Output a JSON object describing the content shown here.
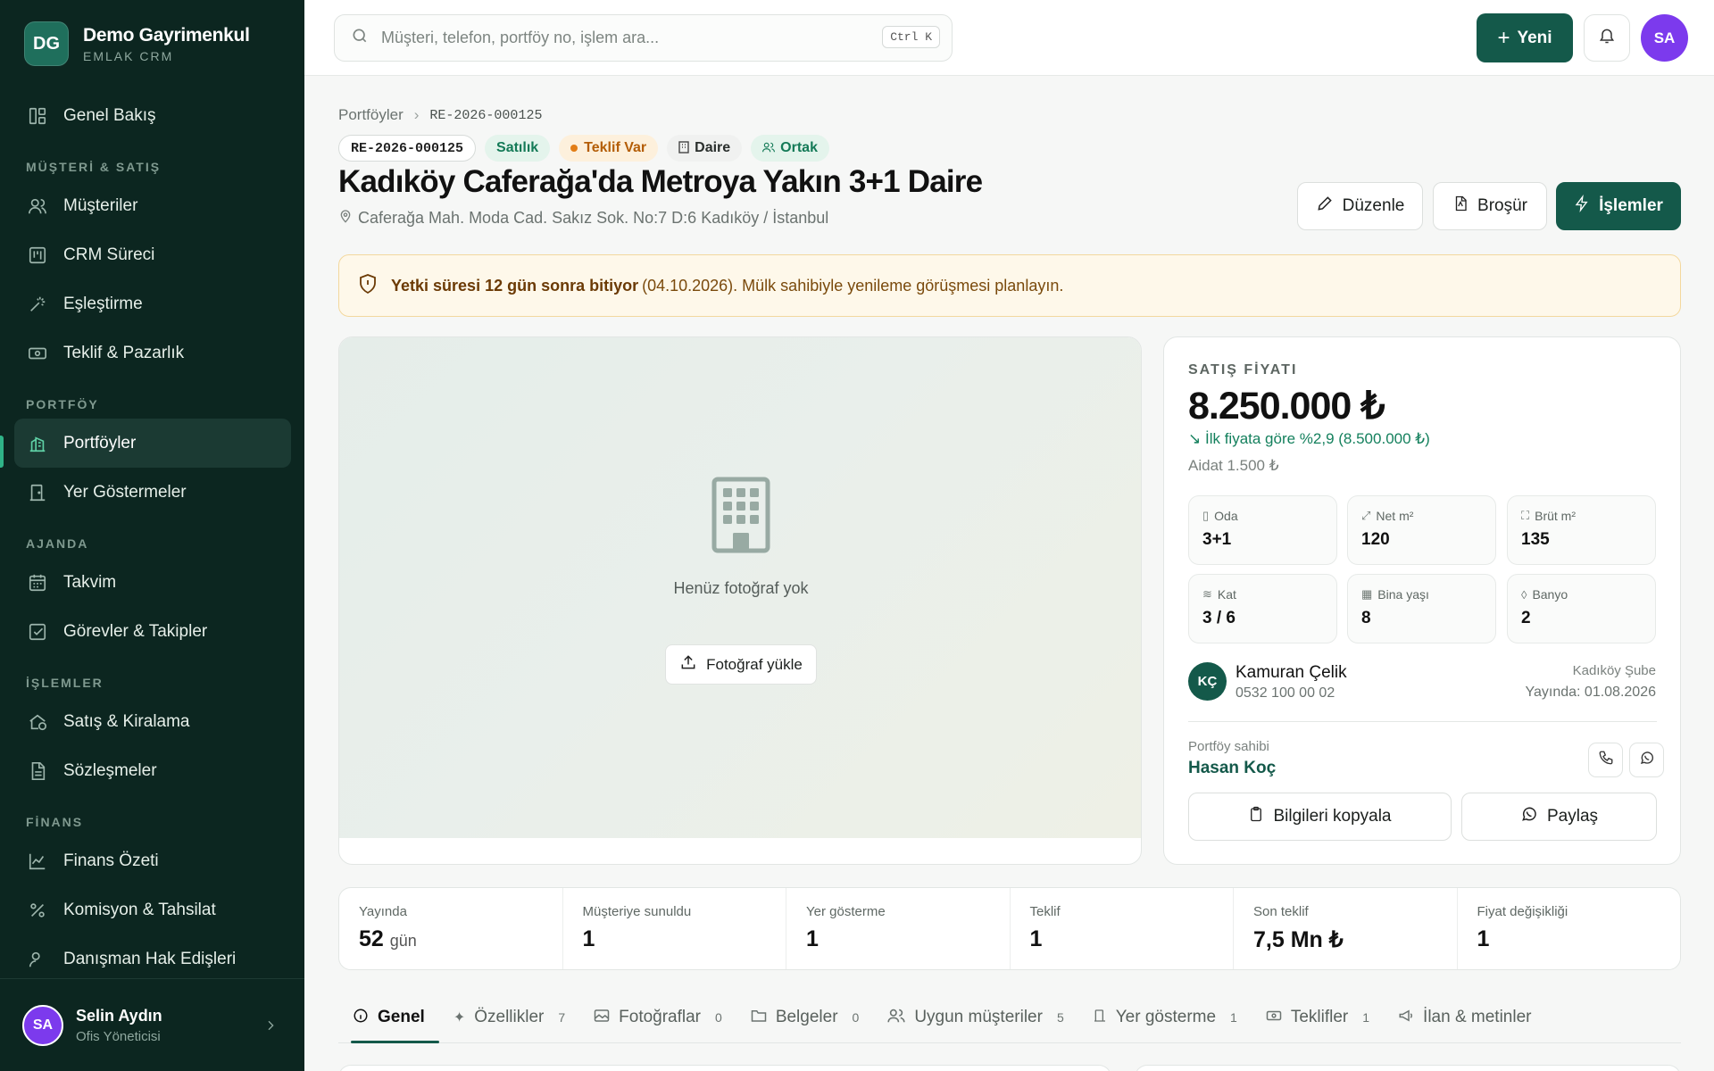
{
  "brand": {
    "logo": "DG",
    "name": "Demo Gayrimenkul",
    "sub": "EMLAK CRM"
  },
  "nav": {
    "overview": "Genel Bakış",
    "section_customers": "MÜŞTERİ & SATIŞ",
    "customers": "Müşteriler",
    "crm": "CRM Süreci",
    "matching": "Eşleştirme",
    "offers": "Teklif & Pazarlık",
    "section_portfolio": "PORTFÖY",
    "portfolios": "Portföyler",
    "showings": "Yer Göstermeler",
    "section_agenda": "AJANDA",
    "calendar": "Takvim",
    "tasks": "Görevler & Takipler",
    "section_ops": "İŞLEMLER",
    "sales": "Satış & Kiralama",
    "contracts": "Sözleşmeler",
    "section_finance": "FİNANS",
    "finance": "Finans Özeti",
    "commission": "Komisyon & Tahsilat",
    "partial": "Danışman Hak Edişleri"
  },
  "user": {
    "initials": "SA",
    "name": "Selin Aydın",
    "role": "Ofis Yöneticisi"
  },
  "topbar": {
    "search_placeholder": "Müşteri, telefon, portföy no, işlem ara...",
    "shortcut": "Ctrl K",
    "new_label": "Yeni",
    "avatar": "SA"
  },
  "breadcrumb": {
    "root": "Portföyler",
    "current": "RE-2026-000125"
  },
  "tags": {
    "code": "RE-2026-000125",
    "status": "Satılık",
    "offer": "Teklif Var",
    "type": "Daire",
    "shared": "Ortak"
  },
  "title": "Kadıköy Caferağa'da Metroya Yakın 3+1 Daire",
  "address": "Caferağa Mah. Moda Cad. Sakız Sok. No:7 D:6 Kadıköy / İstanbul",
  "actions": {
    "edit": "Düzenle",
    "brochure": "Broşür",
    "operations": "İşlemler"
  },
  "alert": {
    "bold": "Yetki süresi 12 gün sonra bitiyor",
    "rest": "(04.10.2026). Mülk sahibiyle yenileme görüşmesi planlayın."
  },
  "photo": {
    "empty": "Henüz fotoğraf yok",
    "upload": "Fotoğraf yükle"
  },
  "price": {
    "label": "SATIŞ FİYATI",
    "value": "8.250.000 ₺",
    "change": "↘ İlk fiyata göre %2,9 (8.500.000 ₺)",
    "aidat": "Aidat 1.500 ₺",
    "specs": [
      {
        "label": "Oda",
        "value": "3+1"
      },
      {
        "label": "Net m²",
        "value": "120"
      },
      {
        "label": "Brüt m²",
        "value": "135"
      },
      {
        "label": "Kat",
        "value": "3 / 6"
      },
      {
        "label": "Bina yaşı",
        "value": "8"
      },
      {
        "label": "Banyo",
        "value": "2"
      }
    ],
    "agent": {
      "initials": "KÇ",
      "name": "Kamuran Çelik",
      "phone": "0532 100 00 02",
      "branch": "Kadıköy Şube",
      "published": "Yayında: 01.08.2026"
    },
    "owner_label": "Portföy sahibi",
    "owner_name": "Hasan Koç",
    "copy": "Bilgileri kopyala",
    "share": "Paylaş"
  },
  "stats": [
    {
      "label": "Yayında",
      "value": "52",
      "unit": "gün"
    },
    {
      "label": "Müşteriye sunuldu",
      "value": "1",
      "unit": ""
    },
    {
      "label": "Yer gösterme",
      "value": "1",
      "unit": ""
    },
    {
      "label": "Teklif",
      "value": "1",
      "unit": ""
    },
    {
      "label": "Son teklif",
      "value": "7,5 Mn ₺",
      "unit": ""
    },
    {
      "label": "Fiyat değişikliği",
      "value": "1",
      "unit": ""
    }
  ],
  "tabs": [
    {
      "label": "Genel",
      "count": ""
    },
    {
      "label": "Özellikler",
      "count": "7"
    },
    {
      "label": "Fotoğraflar",
      "count": "0"
    },
    {
      "label": "Belgeler",
      "count": "0"
    },
    {
      "label": "Uygun müşteriler",
      "count": "5"
    },
    {
      "label": "Yer gösterme",
      "count": "1"
    },
    {
      "label": "Teklifler",
      "count": "1"
    },
    {
      "label": "İlan & metinler",
      "count": ""
    }
  ],
  "colors": {
    "brand": "#14594a",
    "sidebar": "#0c2620",
    "accent": "#2fb387",
    "avatar": "#7c3aed"
  }
}
